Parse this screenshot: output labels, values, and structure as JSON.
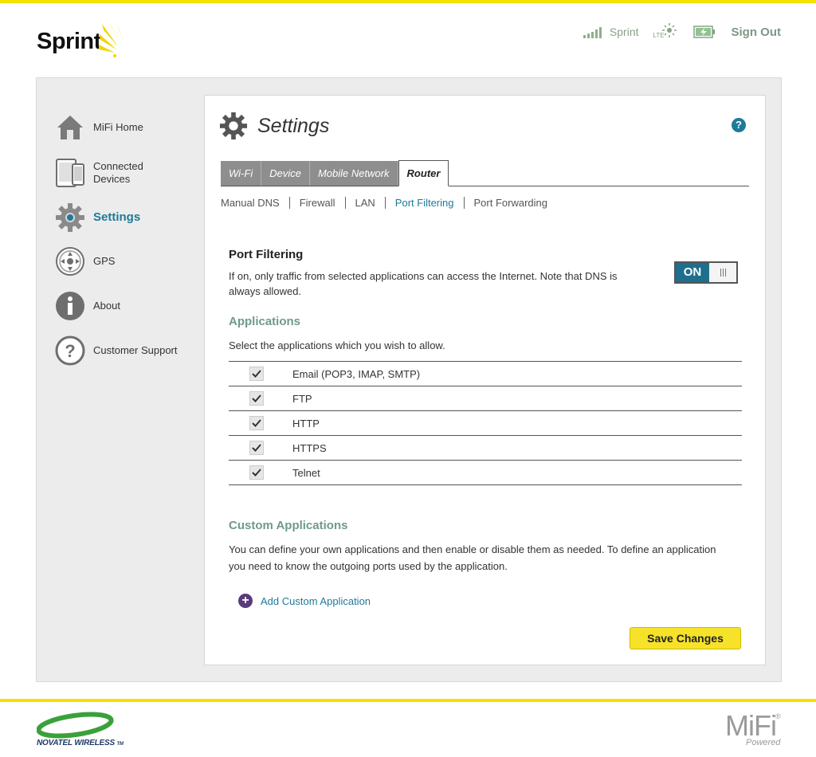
{
  "brand": {
    "logo_text": "Sprint",
    "accent": "#f5e000",
    "teal": "#1e7a99"
  },
  "status": {
    "carrier": "Sprint",
    "network": "LTE",
    "signal_bars": 5,
    "battery_icon": "battery-charging-icon",
    "sign_out": "Sign Out"
  },
  "sidebar": {
    "items": [
      {
        "label": "MiFi Home",
        "icon": "home-icon",
        "active": false
      },
      {
        "label": "Connected Devices",
        "icon": "devices-icon",
        "active": false
      },
      {
        "label": "Settings",
        "icon": "gear-icon",
        "active": true
      },
      {
        "label": "GPS",
        "icon": "gps-icon",
        "active": false
      },
      {
        "label": "About",
        "icon": "info-icon",
        "active": false
      },
      {
        "label": "Customer Support",
        "icon": "question-icon",
        "active": false
      }
    ]
  },
  "page": {
    "title": "Settings",
    "help_icon": "?"
  },
  "tabs": [
    {
      "label": "Wi-Fi",
      "active": false
    },
    {
      "label": "Device",
      "active": false
    },
    {
      "label": "Mobile Network",
      "active": false
    },
    {
      "label": "Router",
      "active": true
    }
  ],
  "subnav": [
    {
      "label": "Manual DNS",
      "active": false
    },
    {
      "label": "Firewall",
      "active": false
    },
    {
      "label": "LAN",
      "active": false
    },
    {
      "label": "Port Filtering",
      "active": true
    },
    {
      "label": "Port Forwarding",
      "active": false
    }
  ],
  "port_filtering": {
    "title": "Port Filtering",
    "description": "If on, only traffic from selected applications can access the Internet. Note that DNS is always allowed.",
    "toggle_label": "ON",
    "enabled": true
  },
  "applications": {
    "title": "Applications",
    "instructions": "Select the applications which you wish to allow.",
    "items": [
      {
        "label": "Email (POP3, IMAP, SMTP)",
        "checked": true
      },
      {
        "label": "FTP",
        "checked": true
      },
      {
        "label": "HTTP",
        "checked": true
      },
      {
        "label": "HTTPS",
        "checked": true
      },
      {
        "label": "Telnet",
        "checked": true
      }
    ]
  },
  "custom_applications": {
    "title": "Custom Applications",
    "description": "You can define your own applications and then enable or disable them as needed. To define an application you need to know the outgoing ports used by the application.",
    "add_label": "Add Custom Application"
  },
  "actions": {
    "save_label": "Save Changes"
  },
  "footer": {
    "partner": "NOVATEL WIRELESS",
    "trademark": "TM",
    "product": "MiFi",
    "registered": "®",
    "powered": "Powered"
  }
}
